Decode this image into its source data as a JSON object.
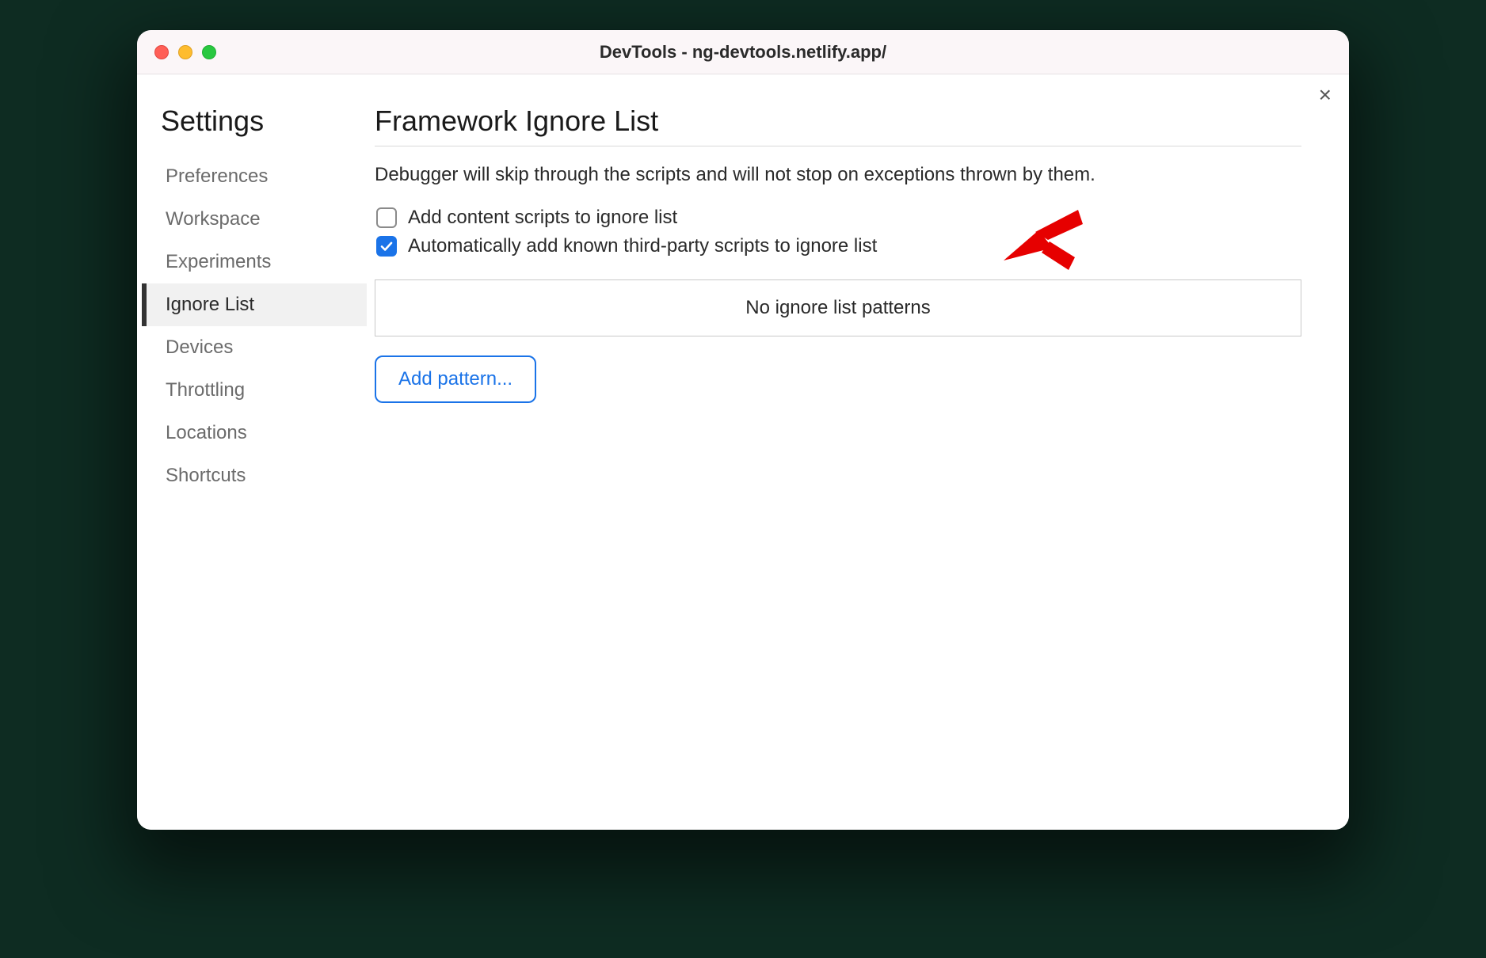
{
  "titlebar": {
    "title": "DevTools - ng-devtools.netlify.app/"
  },
  "close_label": "×",
  "sidebar": {
    "title": "Settings",
    "items": [
      {
        "label": "Preferences",
        "active": false
      },
      {
        "label": "Workspace",
        "active": false
      },
      {
        "label": "Experiments",
        "active": false
      },
      {
        "label": "Ignore List",
        "active": true
      },
      {
        "label": "Devices",
        "active": false
      },
      {
        "label": "Throttling",
        "active": false
      },
      {
        "label": "Locations",
        "active": false
      },
      {
        "label": "Shortcuts",
        "active": false
      }
    ]
  },
  "main": {
    "title": "Framework Ignore List",
    "description": "Debugger will skip through the scripts and will not stop on exceptions thrown by them.",
    "checkboxes": [
      {
        "label": "Add content scripts to ignore list",
        "checked": false
      },
      {
        "label": "Automatically add known third-party scripts to ignore list",
        "checked": true
      }
    ],
    "patterns_empty_text": "No ignore list patterns",
    "add_pattern_label": "Add pattern..."
  },
  "annotation": {
    "arrow_color": "#e60000"
  }
}
